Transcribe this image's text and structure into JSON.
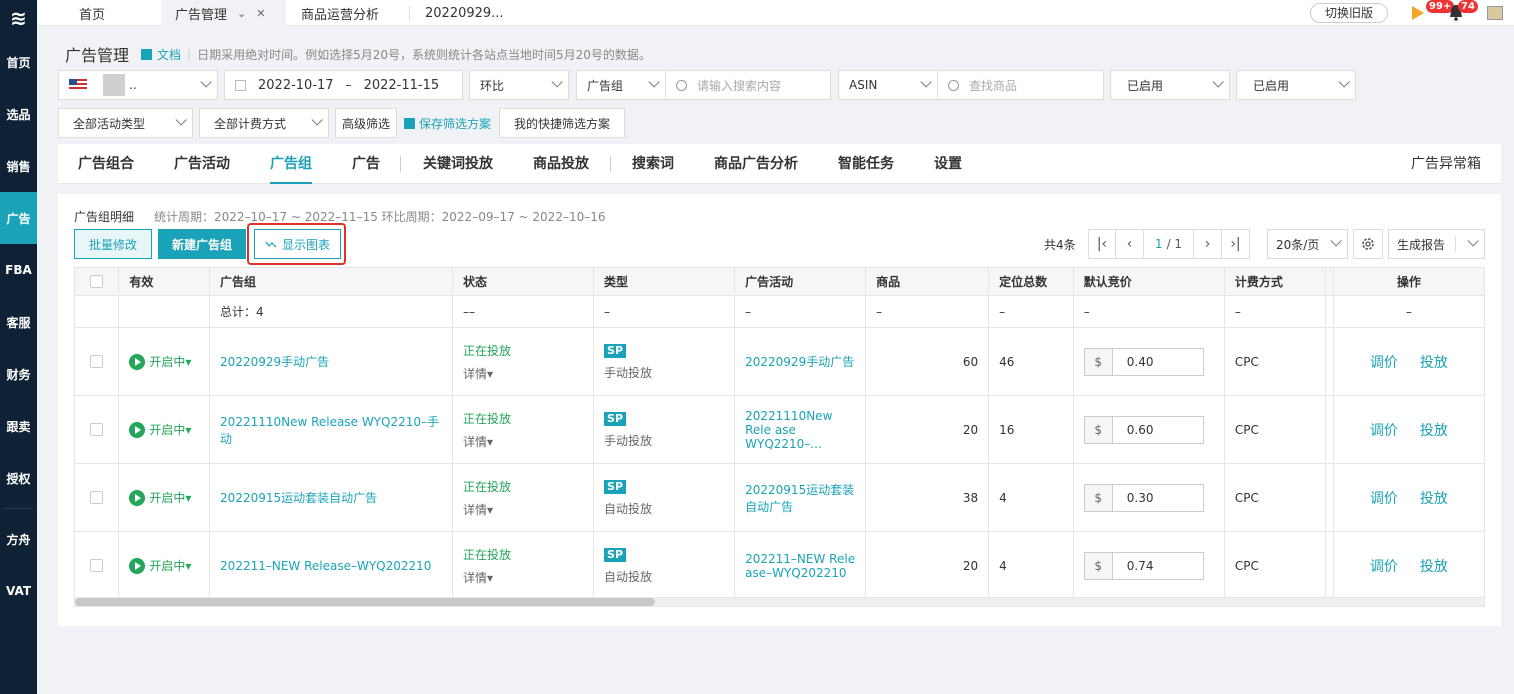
{
  "sidebar": {
    "logo": "≋",
    "items": [
      {
        "label": "首页",
        "active": false
      },
      {
        "label": "选品",
        "active": false
      },
      {
        "label": "销售",
        "active": false
      },
      {
        "label": "广告",
        "active": true
      },
      {
        "label": "FBA",
        "active": false
      },
      {
        "label": "客服",
        "active": false
      },
      {
        "label": "财务",
        "active": false
      },
      {
        "label": "跟卖",
        "active": false
      },
      {
        "label": "授权",
        "active": false
      },
      {
        "label": "方舟",
        "active": false
      },
      {
        "label": "VAT",
        "active": false
      }
    ]
  },
  "topbar": {
    "tabs": [
      "首页",
      "广告管理",
      "商品运营分析",
      "20220929..."
    ],
    "switch_old": "切换旧版",
    "badge_flag": "99+",
    "badge_bell": "74"
  },
  "header": {
    "title": "广告管理",
    "doc": "文档",
    "hint": "日期采用绝对时间。例如选择5月20号，系统则统计各站点当地时间5月20号的数据。"
  },
  "filters": {
    "store_suffix": "..",
    "date_start": "2022-10-17",
    "date_sep": "–",
    "date_end": "2022-11-15",
    "compare": "环比",
    "group_select": "广告组",
    "search_placeholder": "请输入搜索内容",
    "asin_select": "ASIN",
    "product_placeholder": "查找商品",
    "status1": "已启用",
    "status2": "已启用",
    "activity_type": "全部活动类型",
    "billing": "全部计费方式",
    "advanced": "高级筛选",
    "save_scheme": "保存筛选方案",
    "my_scheme": "我的快捷筛选方案"
  },
  "tabs": {
    "items": [
      "广告组合",
      "广告活动",
      "广告组",
      "广告",
      "关键词投放",
      "商品投放",
      "搜索词",
      "商品广告分析",
      "智能任务",
      "设置"
    ],
    "active": "广告组",
    "right": "广告异常箱"
  },
  "panel": {
    "title": "广告组明细",
    "meta": "统计周期：2022–10–17 ~ 2022–11–15 环比周期：2022–09–17 ~ 2022–10–16",
    "bulk_edit": "批量修改",
    "new_group": "新建广告组",
    "show_chart": "显示图表",
    "total": "共4条",
    "page_current": "1",
    "page_total": "/ 1",
    "page_size": "20条/页",
    "report": "生成报告"
  },
  "table": {
    "headers": [
      "有效",
      "广告组",
      "状态",
      "类型",
      "广告活动",
      "商品",
      "定位总数",
      "默认竞价",
      "计费方式",
      "操作"
    ],
    "summary": {
      "label": "总计：4",
      "status": "––",
      "dash": "–"
    },
    "rows": [
      {
        "valid": "开启中",
        "group": "20220929手动广告",
        "status": "正在投放",
        "detail": "详情",
        "type_badge": "SP",
        "type": "手动投放",
        "campaign": "20220929手动广告",
        "products": "60",
        "targets": "46",
        "currency": "$",
        "bid": "0.40",
        "billing": "CPC",
        "op1": "调价",
        "op2": "投放"
      },
      {
        "valid": "开启中",
        "group": "20221110New Release WYQ2210–手动",
        "status": "正在投放",
        "detail": "详情",
        "type_badge": "SP",
        "type": "手动投放",
        "campaign": "20221110New Rele ase WYQ2210–...",
        "products": "20",
        "targets": "16",
        "currency": "$",
        "bid": "0.60",
        "billing": "CPC",
        "op1": "调价",
        "op2": "投放"
      },
      {
        "valid": "开启中",
        "group": "20220915运动套装自动广告",
        "status": "正在投放",
        "detail": "详情",
        "type_badge": "SP",
        "type": "自动投放",
        "campaign": "20220915运动套装自动广告",
        "products": "38",
        "targets": "4",
        "currency": "$",
        "bid": "0.30",
        "billing": "CPC",
        "op1": "调价",
        "op2": "投放"
      },
      {
        "valid": "开启中",
        "group": "202211–NEW Release–WYQ202210",
        "status": "正在投放",
        "detail": "详情",
        "type_badge": "SP",
        "type": "自动投放",
        "campaign": "202211–NEW Rele ase–WYQ202210",
        "products": "20",
        "targets": "4",
        "currency": "$",
        "bid": "0.74",
        "billing": "CPC",
        "op1": "调价",
        "op2": "投放"
      }
    ]
  },
  "colors": {
    "accent": "#1aa3b8",
    "sidebar": "#0f2235",
    "green": "#23a55a",
    "highlight": "#e03030"
  }
}
